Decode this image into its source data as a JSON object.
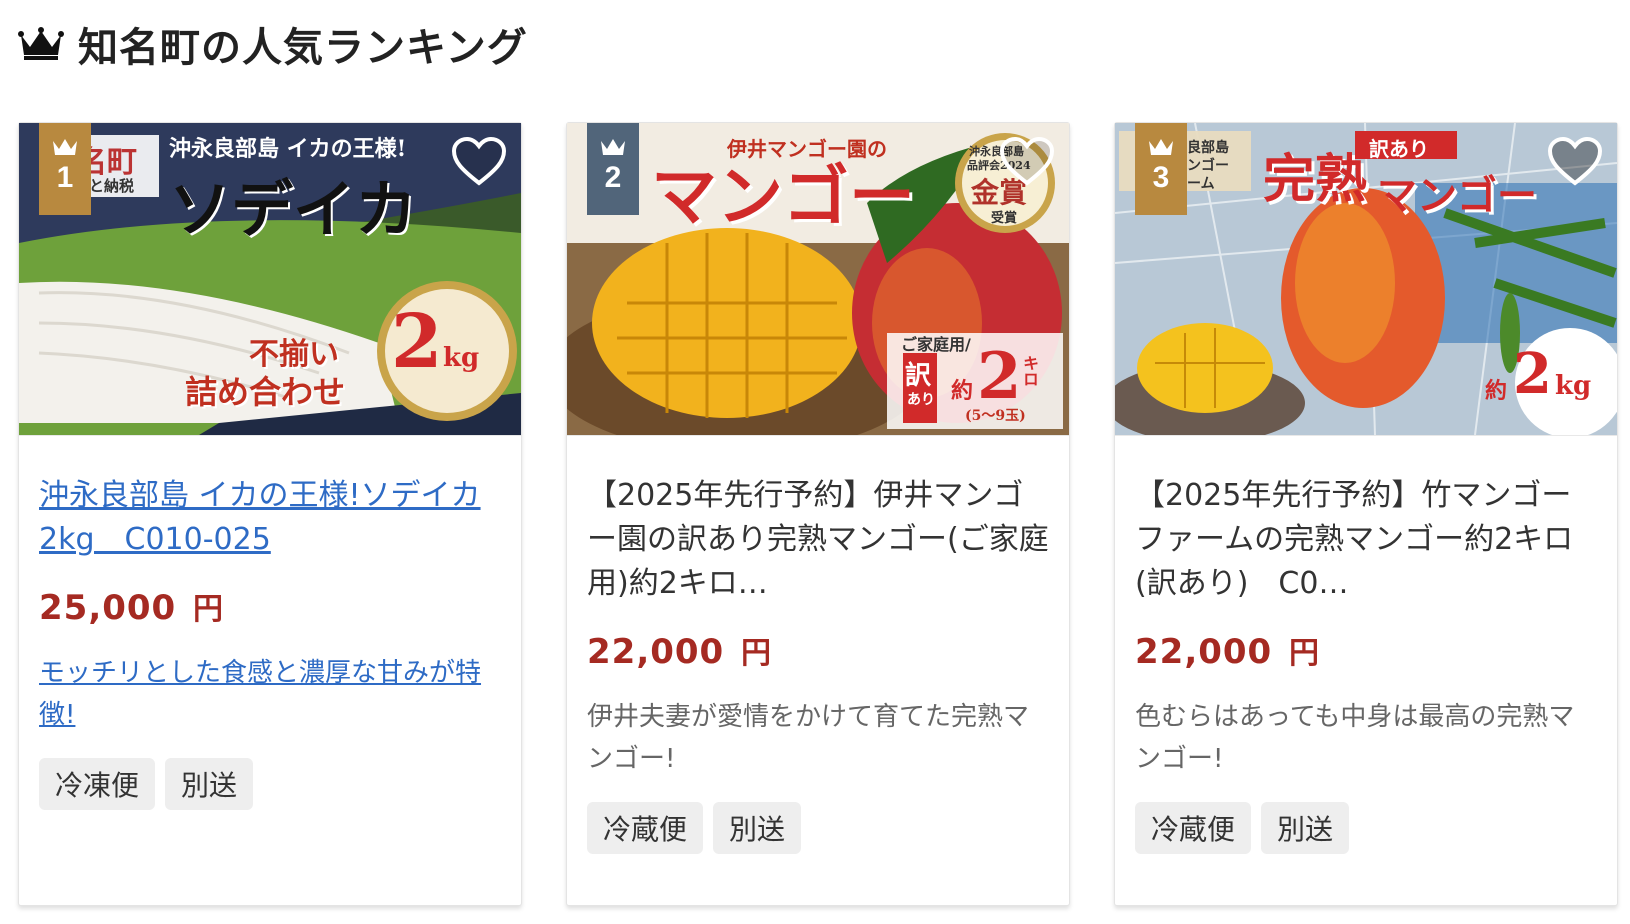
{
  "header": {
    "title": "知名町の人気ランキング",
    "icon": "crown-icon"
  },
  "colors": {
    "gold_badge": "#b8893f",
    "silver_badge": "#51657a",
    "link": "#2e6bc5",
    "price": "#a52a22",
    "tag_bg": "#eeeeee"
  },
  "cards": [
    {
      "rank": "1",
      "image": {
        "town": "名町",
        "town_sub": "と納税",
        "catch": "沖永良部島 イカの王様!",
        "product": "ソデイカ",
        "badge1": "不揃い",
        "badge2": "詰め合わせ",
        "weight": "2",
        "unit": "kg"
      },
      "title": "沖永良部島 イカの王様!ソデイカ2kg　C010-025",
      "price": "25,000",
      "yen": "円",
      "description": "モッチリとした食感と濃厚な甘みが特徴!",
      "tags": [
        "冷凍便",
        "別送"
      ]
    },
    {
      "rank": "2",
      "image": {
        "catch": "伊井マンゴー園の",
        "product": "マンゴー",
        "award_top": "沖永良部島",
        "award_mid": "品評会2024",
        "award": "金賞",
        "award_bottom": "受賞",
        "family": "ご家庭用/",
        "wakeari": "訳",
        "ari": "あり",
        "approx": "約",
        "weight": "2",
        "unit": "キロ",
        "count": "(5〜9玉)"
      },
      "title": "【2025年先行予約】伊井マンゴー園の訳あり完熟マンゴー(ご家庭用)約2キロ…",
      "price": "22,000",
      "yen": "円",
      "description": "伊井夫妻が愛情をかけて育てた完熟マンゴー!",
      "tags": [
        "冷蔵便",
        "別送"
      ]
    },
    {
      "rank": "3",
      "image": {
        "farm1": "良部島",
        "farm2": "ンゴー",
        "farm3": "ーム",
        "catch1": "完熟",
        "wakeari": "訳あり",
        "product": "マンゴー",
        "approx": "約",
        "weight": "2",
        "unit": "kg"
      },
      "title": "【2025年先行予約】竹マンゴーファームの完熟マンゴー約2キロ(訳あり)　C0…",
      "price": "22,000",
      "yen": "円",
      "description": "色むらはあっても中身は最高の完熟マンゴー!",
      "tags": [
        "冷蔵便",
        "別送"
      ]
    }
  ]
}
